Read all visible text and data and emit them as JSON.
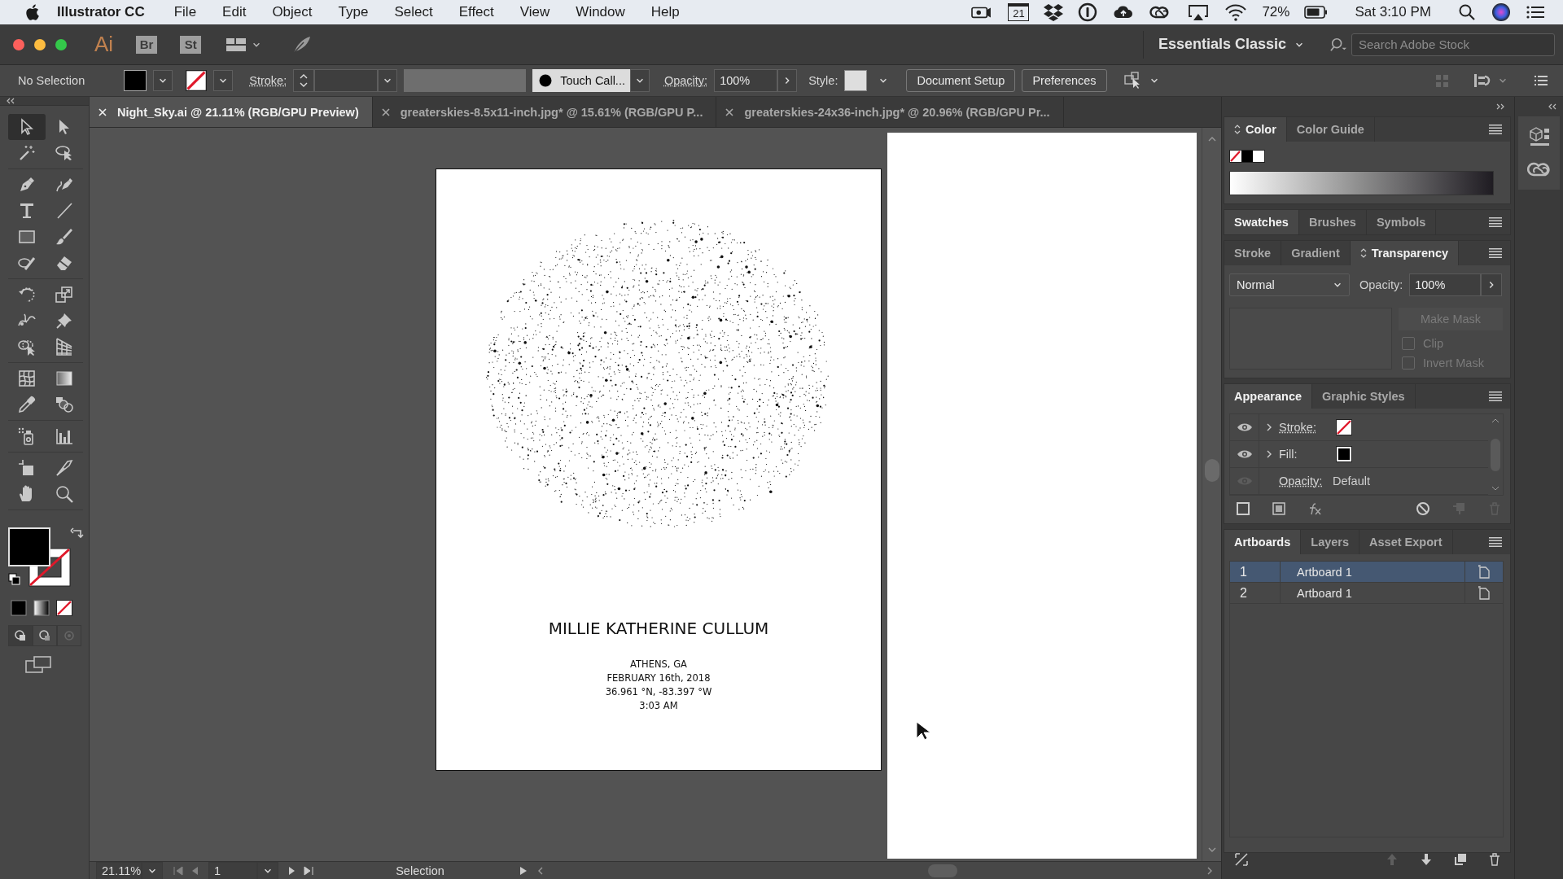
{
  "menu_bar": {
    "app_name": "Illustrator CC",
    "menus": [
      "File",
      "Edit",
      "Object",
      "Type",
      "Select",
      "Effect",
      "View",
      "Window",
      "Help"
    ],
    "calendar_day": "21",
    "battery": "72%",
    "clock": "Sat 3:10 PM"
  },
  "app_bar": {
    "logo": "Ai",
    "bridge": "Br",
    "stock": "St",
    "workspace": "Essentials Classic",
    "search": {
      "placeholder": "Search Adobe Stock"
    }
  },
  "control_bar": {
    "selection": "No Selection",
    "stroke_label": "Stroke:",
    "brush": "Touch Call...",
    "opacity_label": "Opacity:",
    "opacity": "100%",
    "style_label": "Style:",
    "buttons": [
      "Document Setup",
      "Preferences"
    ]
  },
  "document_tabs": [
    {
      "title": "Night_Sky.ai @ 21.11% (RGB/GPU Preview)",
      "selected": true
    },
    {
      "title": "greaterskies-8.5x11-inch.jpg* @ 15.61% (RGB/GPU P...",
      "selected": false
    },
    {
      "title": "greaterskies-24x36-inch.jpg* @ 20.96% (RGB/GPU Pr...",
      "selected": false
    }
  ],
  "toolbox": {
    "tools": [
      {
        "selected": true
      },
      {
        "selected": false
      },
      {
        "selected": false
      },
      {
        "selected": false
      },
      {
        "selected": false
      },
      {
        "selected": false
      },
      {
        "selected": false
      },
      {
        "selected": false
      },
      {
        "selected": false
      },
      {
        "selected": false
      },
      {
        "selected": false
      },
      {
        "selected": false
      },
      {
        "selected": false
      },
      {
        "selected": false
      },
      {
        "selected": false
      },
      {
        "selected": false
      },
      {
        "selected": false
      },
      {
        "selected": false
      },
      {
        "selected": false
      },
      {
        "selected": false
      },
      {
        "selected": false
      },
      {
        "selected": false
      },
      {
        "selected": false
      },
      {
        "selected": false
      },
      {
        "selected": false
      },
      {
        "selected": false
      },
      {
        "selected": false
      },
      {
        "selected": false
      }
    ]
  },
  "artboard": {
    "name": "MILLIE KATHERINE CULLUM",
    "details": [
      "ATHENS, GA",
      "FEBRUARY 16th, 2018",
      "36.961 °N, -83.397 °W",
      "3:03 AM"
    ]
  },
  "color_panel": {
    "tabs": [
      {
        "label": "Color",
        "selected": true
      },
      {
        "label": "Color Guide",
        "selected": false
      }
    ]
  },
  "swatches_panel": {
    "tabs": [
      {
        "label": "Swatches",
        "selected": true
      },
      {
        "label": "Brushes",
        "selected": false
      },
      {
        "label": "Symbols",
        "selected": false
      }
    ]
  },
  "transparency_panel": {
    "tabs": [
      {
        "label": "Stroke",
        "selected": false
      },
      {
        "label": "Gradient",
        "selected": false
      },
      {
        "label": "Transparency",
        "selected": true
      }
    ],
    "blend_mode": "Normal",
    "opacity_label": "Opacity:",
    "opacity": "100%",
    "make_mask": {
      "label": "Make Mask",
      "disabled": true
    },
    "options": [
      {
        "label": "Clip",
        "checked": false,
        "disabled": true
      },
      {
        "label": "Invert Mask",
        "checked": false,
        "disabled": true
      }
    ]
  },
  "appearance_panel": {
    "tabs": [
      {
        "label": "Appearance",
        "selected": true
      },
      {
        "label": "Graphic Styles",
        "selected": false
      }
    ],
    "rows": [
      {
        "kind": "stroke",
        "label": "Stroke:",
        "visible": true
      },
      {
        "kind": "fill",
        "label": "Fill:",
        "visible": true
      },
      {
        "kind": "opacity",
        "label": "Opacity:",
        "value": "Default",
        "visible": false
      }
    ]
  },
  "artboards_panel": {
    "tabs": [
      {
        "label": "Artboards",
        "selected": true
      },
      {
        "label": "Layers",
        "selected": false
      },
      {
        "label": "Asset Export",
        "selected": false
      }
    ],
    "rows": [
      {
        "number": "1",
        "name": "Artboard 1",
        "selected": true
      },
      {
        "number": "2",
        "name": "Artboard 1",
        "selected": false
      }
    ]
  },
  "status_bar": {
    "zoom": "21.11%",
    "artboard": "1",
    "tool": "Selection"
  }
}
